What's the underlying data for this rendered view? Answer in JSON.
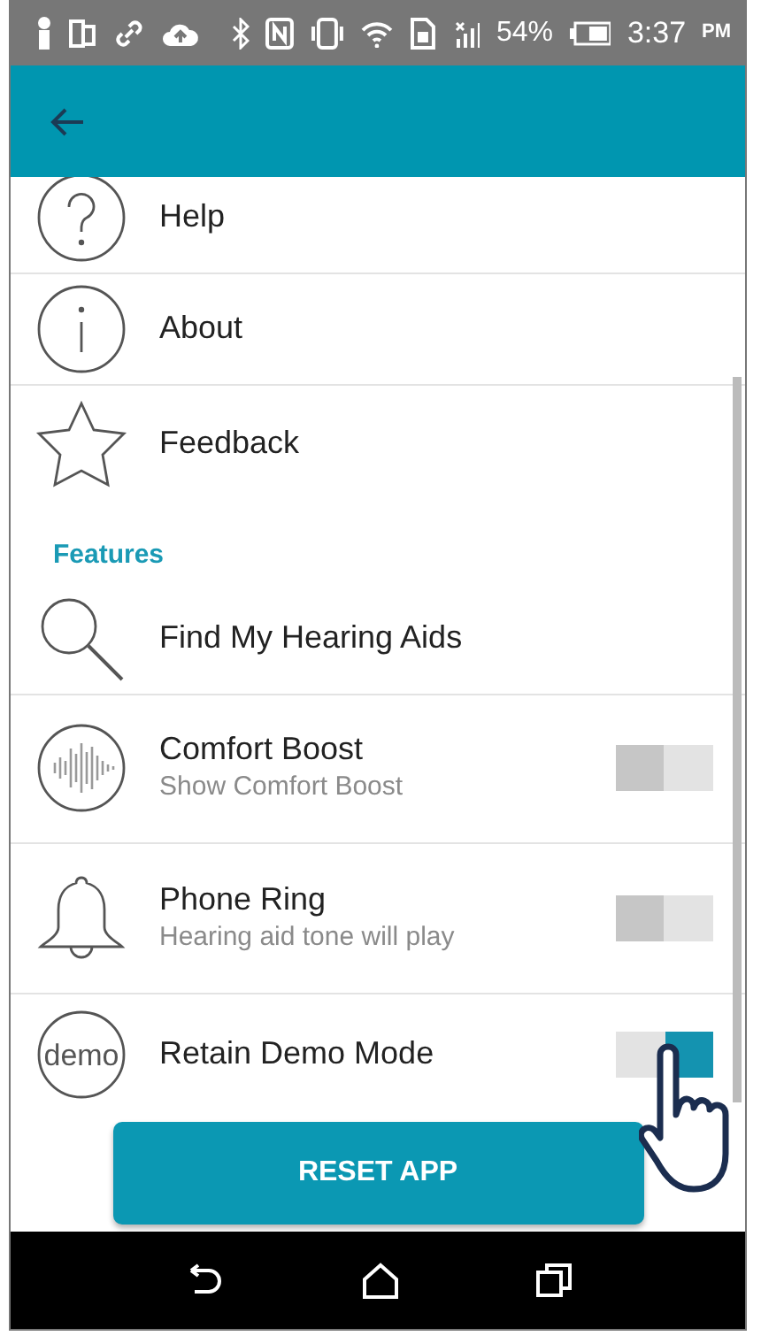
{
  "status_bar": {
    "battery": "54%",
    "time": "3:37",
    "time_suffix": "PM"
  },
  "items": [
    {
      "kind": "item",
      "title": "Help"
    },
    {
      "kind": "item",
      "title": "About"
    },
    {
      "kind": "item",
      "title": "Feedback"
    },
    {
      "kind": "header",
      "title": "Features"
    },
    {
      "kind": "item",
      "title": "Find My Hearing Aids"
    },
    {
      "kind": "toggle",
      "title": "Comfort Boost",
      "subtitle": "Show Comfort Boost",
      "on": false
    },
    {
      "kind": "toggle",
      "title": "Phone Ring",
      "subtitle": "Hearing aid tone will play",
      "on": false
    },
    {
      "kind": "toggle",
      "title": "Retain Demo Mode",
      "icon_text": "demo",
      "on": true
    }
  ],
  "button": "RESET APP"
}
